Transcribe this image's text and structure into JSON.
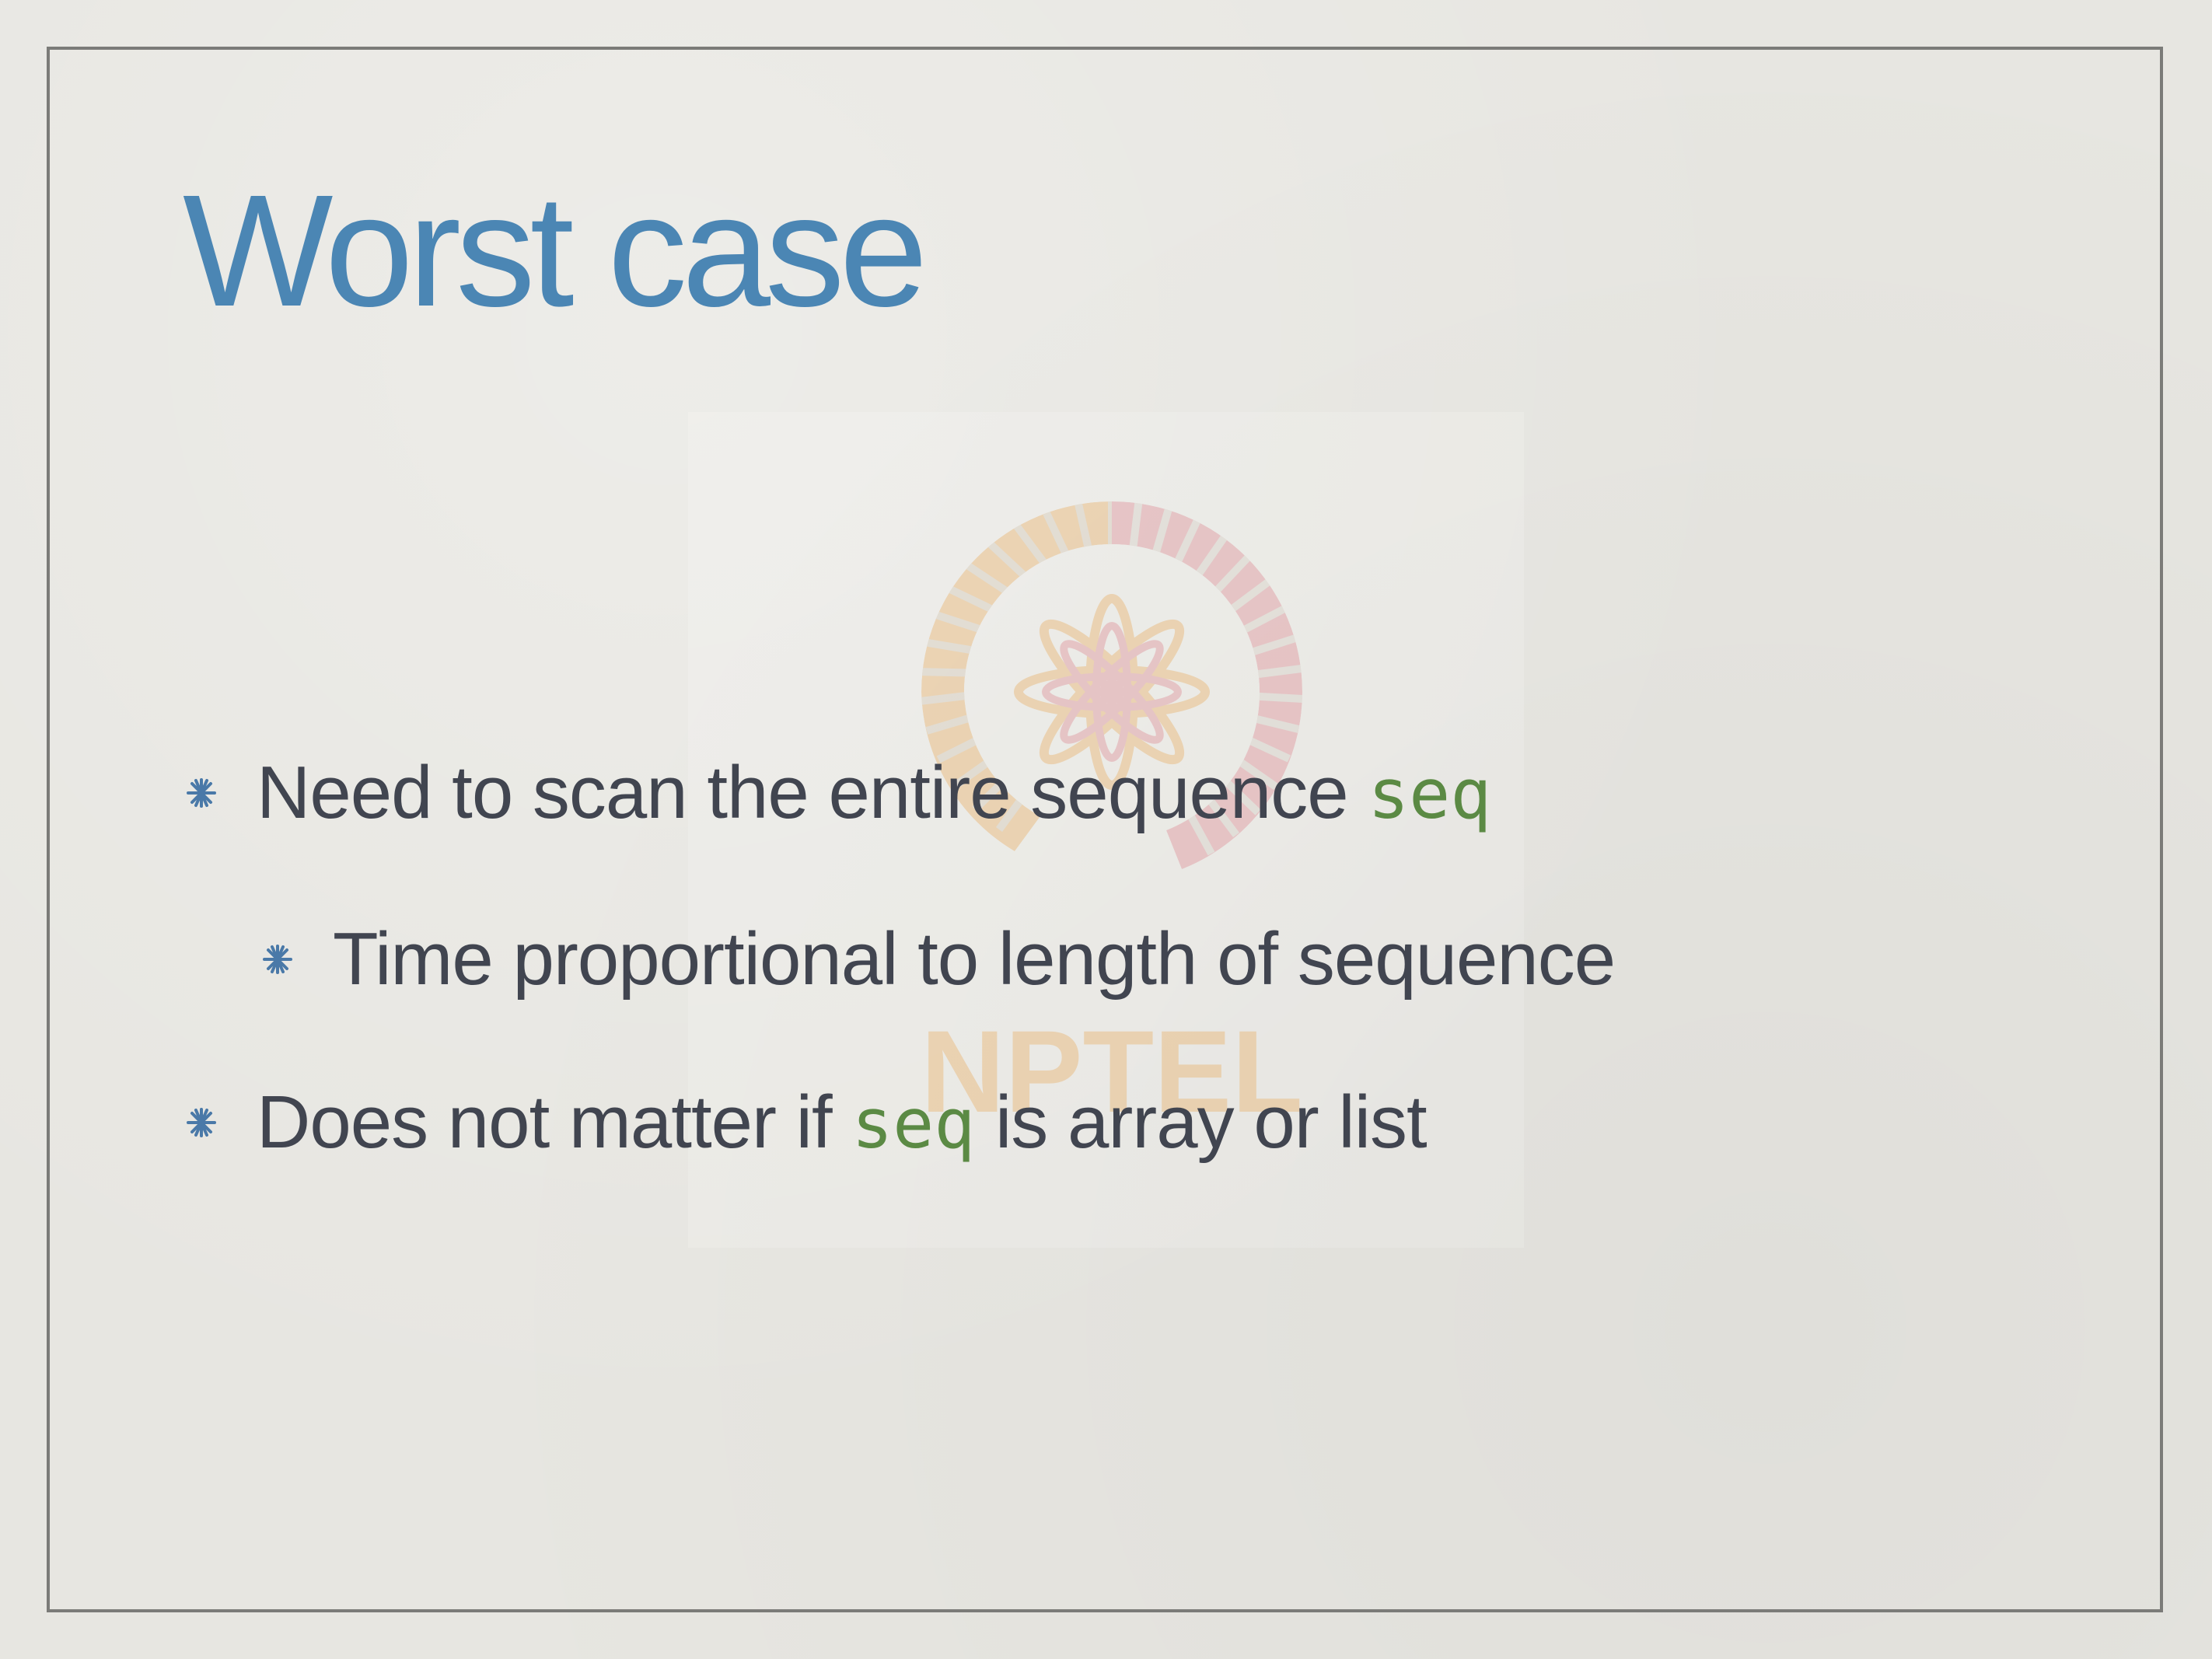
{
  "slide": {
    "title": "Worst case",
    "bullets": [
      {
        "prefix": "Need to scan the entire sequence ",
        "code": "seq",
        "suffix": ""
      },
      {
        "text": "Time proportional to length of sequence"
      },
      {
        "prefix": "Does not matter if ",
        "code": "seq",
        "suffix": " is array or list"
      }
    ]
  },
  "watermark": {
    "text": "NPTEL"
  },
  "colors": {
    "background": "#e7e6e1",
    "frame": "#7b7b78",
    "title": "#4b86b4",
    "body_text": "#414550",
    "code": "#5b8a44",
    "bullet": "#4a79a8",
    "watermark_orange": "#e9b26b",
    "watermark_pink": "#df8f98"
  },
  "icons": {
    "bullet": "asterisk-bullet-icon",
    "watermark": "nptel-logo-icon"
  }
}
